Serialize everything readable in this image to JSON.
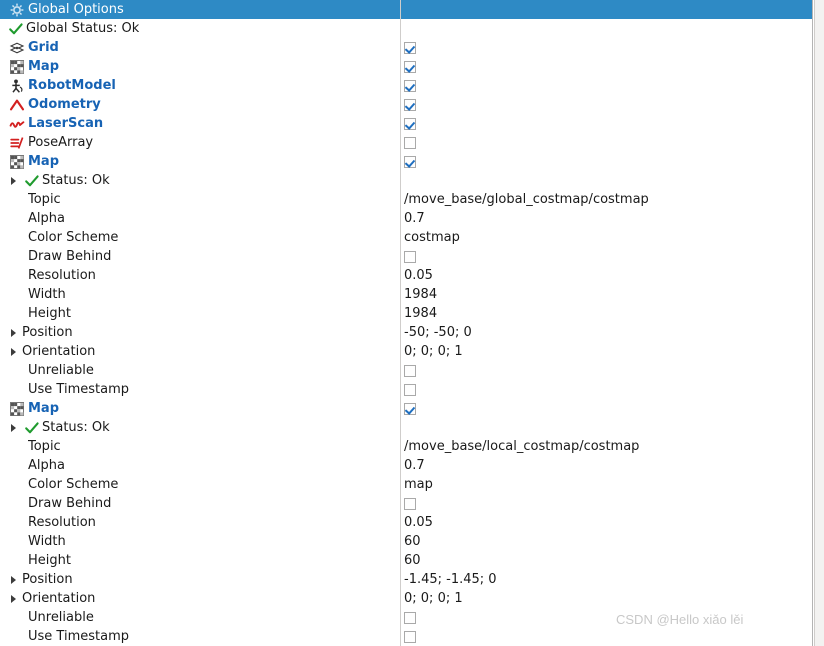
{
  "panel": {
    "title": "Global Options",
    "title_icon": "gear-icon",
    "selection_color": "#2e8ac5",
    "display_name_color": "#1763b4",
    "status_ok_color": "#1f9b2e"
  },
  "watermark": "CSDN @Hello xiǎo lěi",
  "rows": [
    {
      "name": "Global Options",
      "kind": "title",
      "icon": "gear-icon",
      "indent": 0,
      "twisty": false,
      "value_type": "none",
      "value": ""
    },
    {
      "name": "Global Status: Ok",
      "kind": "status",
      "icon": "check-icon",
      "indent": 0,
      "twisty": false,
      "value_type": "none",
      "value": ""
    },
    {
      "name": "Grid",
      "kind": "display",
      "icon": "grid-icon",
      "indent": 0,
      "twisty": false,
      "value_type": "checkbox",
      "value": "checked"
    },
    {
      "name": "Map",
      "kind": "display",
      "icon": "map-icon",
      "indent": 0,
      "twisty": false,
      "value_type": "checkbox",
      "value": "checked"
    },
    {
      "name": "RobotModel",
      "kind": "display",
      "icon": "robotmodel-icon",
      "indent": 0,
      "twisty": false,
      "value_type": "checkbox",
      "value": "checked"
    },
    {
      "name": "Odometry",
      "kind": "display",
      "icon": "odometry-icon",
      "indent": 0,
      "twisty": false,
      "value_type": "checkbox",
      "value": "checked"
    },
    {
      "name": "LaserScan",
      "kind": "display",
      "icon": "laserscan-icon",
      "indent": 0,
      "twisty": false,
      "value_type": "checkbox",
      "value": "checked"
    },
    {
      "name": "PoseArray",
      "kind": "plain",
      "icon": "posearray-icon",
      "indent": 0,
      "twisty": false,
      "value_type": "checkbox",
      "value": "unchecked"
    },
    {
      "name": "Map",
      "kind": "display",
      "icon": "map-icon",
      "indent": 0,
      "twisty": false,
      "value_type": "checkbox",
      "value": "checked"
    },
    {
      "name": "Status: Ok",
      "kind": "status",
      "icon": "check-icon",
      "indent": 1,
      "twisty": true,
      "value_type": "none",
      "value": ""
    },
    {
      "name": "Topic",
      "kind": "plain",
      "icon": "none",
      "indent": 2,
      "twisty": false,
      "value_type": "text",
      "value": "/move_base/global_costmap/costmap"
    },
    {
      "name": "Alpha",
      "kind": "plain",
      "icon": "none",
      "indent": 2,
      "twisty": false,
      "value_type": "text",
      "value": "0.7"
    },
    {
      "name": "Color Scheme",
      "kind": "plain",
      "icon": "none",
      "indent": 2,
      "twisty": false,
      "value_type": "text",
      "value": "costmap"
    },
    {
      "name": "Draw Behind",
      "kind": "plain",
      "icon": "none",
      "indent": 2,
      "twisty": false,
      "value_type": "checkbox",
      "value": "unchecked"
    },
    {
      "name": "Resolution",
      "kind": "plain",
      "icon": "none",
      "indent": 2,
      "twisty": false,
      "value_type": "text",
      "value": "0.05"
    },
    {
      "name": "Width",
      "kind": "plain",
      "icon": "none",
      "indent": 2,
      "twisty": false,
      "value_type": "text",
      "value": "1984"
    },
    {
      "name": "Height",
      "kind": "plain",
      "icon": "none",
      "indent": 2,
      "twisty": false,
      "value_type": "text",
      "value": "1984"
    },
    {
      "name": "Position",
      "kind": "plain",
      "icon": "none",
      "indent": 1,
      "twisty": true,
      "value_type": "text",
      "value": "-50; -50; 0"
    },
    {
      "name": "Orientation",
      "kind": "plain",
      "icon": "none",
      "indent": 1,
      "twisty": true,
      "value_type": "text",
      "value": "0; 0; 0; 1"
    },
    {
      "name": "Unreliable",
      "kind": "plain",
      "icon": "none",
      "indent": 2,
      "twisty": false,
      "value_type": "checkbox",
      "value": "unchecked"
    },
    {
      "name": "Use Timestamp",
      "kind": "plain",
      "icon": "none",
      "indent": 2,
      "twisty": false,
      "value_type": "checkbox",
      "value": "unchecked"
    },
    {
      "name": "Map",
      "kind": "display",
      "icon": "map-icon",
      "indent": 0,
      "twisty": false,
      "value_type": "checkbox",
      "value": "checked"
    },
    {
      "name": "Status: Ok",
      "kind": "status",
      "icon": "check-icon",
      "indent": 1,
      "twisty": true,
      "value_type": "none",
      "value": ""
    },
    {
      "name": "Topic",
      "kind": "plain",
      "icon": "none",
      "indent": 2,
      "twisty": false,
      "value_type": "text",
      "value": "/move_base/local_costmap/costmap"
    },
    {
      "name": "Alpha",
      "kind": "plain",
      "icon": "none",
      "indent": 2,
      "twisty": false,
      "value_type": "text",
      "value": "0.7"
    },
    {
      "name": "Color Scheme",
      "kind": "plain",
      "icon": "none",
      "indent": 2,
      "twisty": false,
      "value_type": "text",
      "value": "map"
    },
    {
      "name": "Draw Behind",
      "kind": "plain",
      "icon": "none",
      "indent": 2,
      "twisty": false,
      "value_type": "checkbox",
      "value": "unchecked"
    },
    {
      "name": "Resolution",
      "kind": "plain",
      "icon": "none",
      "indent": 2,
      "twisty": false,
      "value_type": "text",
      "value": "0.05"
    },
    {
      "name": "Width",
      "kind": "plain",
      "icon": "none",
      "indent": 2,
      "twisty": false,
      "value_type": "text",
      "value": "60"
    },
    {
      "name": "Height",
      "kind": "plain",
      "icon": "none",
      "indent": 2,
      "twisty": false,
      "value_type": "text",
      "value": "60"
    },
    {
      "name": "Position",
      "kind": "plain",
      "icon": "none",
      "indent": 1,
      "twisty": true,
      "value_type": "text",
      "value": "-1.45; -1.45; 0"
    },
    {
      "name": "Orientation",
      "kind": "plain",
      "icon": "none",
      "indent": 1,
      "twisty": true,
      "value_type": "text",
      "value": "0; 0; 0; 1"
    },
    {
      "name": "Unreliable",
      "kind": "plain",
      "icon": "none",
      "indent": 2,
      "twisty": false,
      "value_type": "checkbox",
      "value": "unchecked"
    },
    {
      "name": "Use Timestamp",
      "kind": "plain",
      "icon": "none",
      "indent": 2,
      "twisty": false,
      "value_type": "checkbox",
      "value": "unchecked"
    }
  ]
}
